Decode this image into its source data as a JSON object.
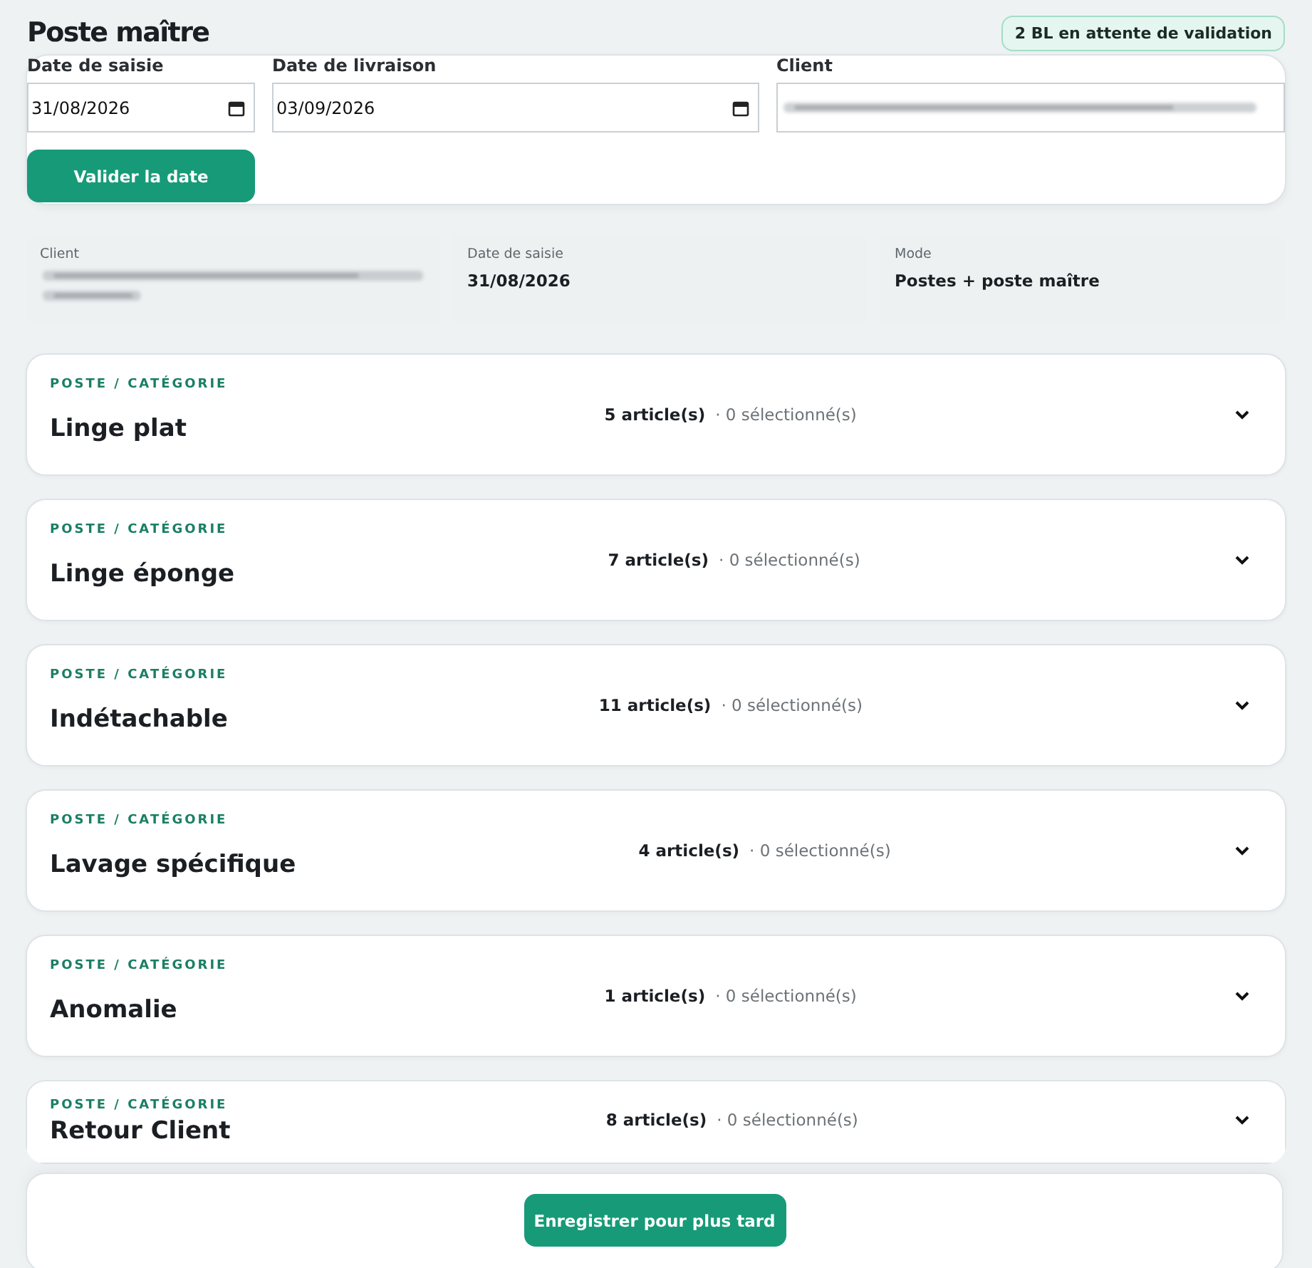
{
  "title": "Poste maître",
  "pending_badge": "2 BL en attente de validation",
  "form": {
    "fields": [
      {
        "kind": "date",
        "label": "Date de saisie",
        "value": "31/08/2026"
      },
      {
        "kind": "date",
        "label": "Date de livraison",
        "value": "03/09/2026"
      },
      {
        "kind": "redacted",
        "label": "Client"
      }
    ],
    "button": "Valider la date"
  },
  "summary": [
    {
      "kind": "redacted",
      "label": "Client"
    },
    {
      "kind": "text",
      "label": "Date de saisie",
      "value": "31/08/2026"
    },
    {
      "kind": "text",
      "label": "Mode",
      "value": "Postes + poste maître"
    }
  ],
  "categories": [
    {
      "eyebrow": "POSTE / CATÉGORIE",
      "name": "Linge plat",
      "count": "5 article(s)",
      "selected": "· 0 sélectionné(s)",
      "expanded": false
    },
    {
      "eyebrow": "POSTE / CATÉGORIE",
      "name": "Linge éponge",
      "count": "7 article(s)",
      "selected": "· 0 sélectionné(s)",
      "expanded": false
    },
    {
      "eyebrow": "POSTE / CATÉGORIE",
      "name": "Indétachable",
      "count": "11 article(s)",
      "selected": "· 0 sélectionné(s)",
      "expanded": false
    },
    {
      "eyebrow": "POSTE / CATÉGORIE",
      "name": "Lavage spécifique",
      "count": "4 article(s)",
      "selected": "· 0 sélectionné(s)",
      "expanded": false
    },
    {
      "eyebrow": "POSTE / CATÉGORIE",
      "name": "Anomalie",
      "count": "1 article(s)",
      "selected": "· 0 sélectionné(s)",
      "expanded": false
    },
    {
      "eyebrow": "POSTE / CATÉGORIE",
      "name": "Retour Client",
      "count": "8 article(s)",
      "selected": "· 0 sélectionné(s)",
      "expanded": false
    }
  ],
  "footer_button": "Enregistrer pour plus tard"
}
